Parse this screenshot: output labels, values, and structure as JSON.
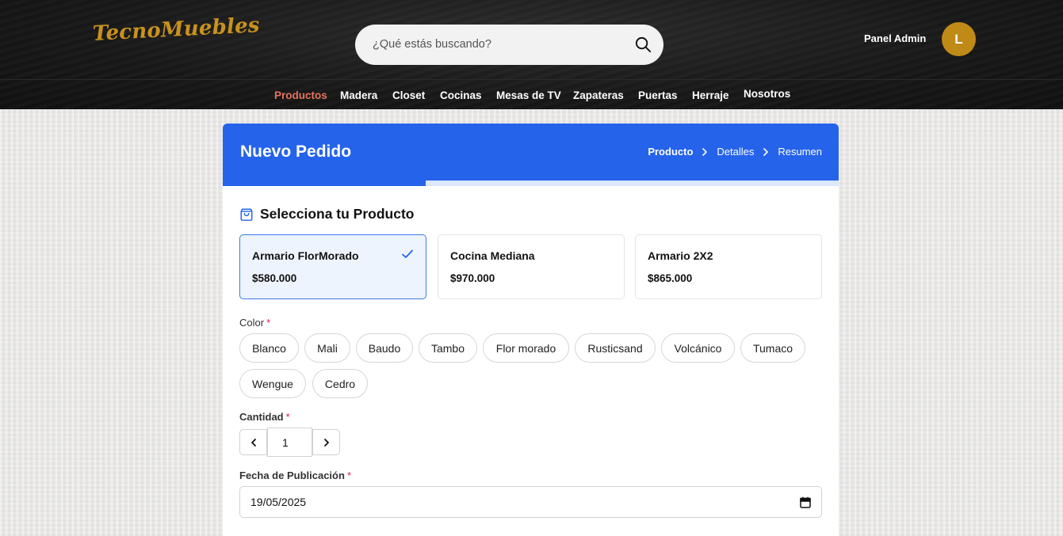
{
  "header": {
    "logo": "TecnoMuebles",
    "search_placeholder": "¿Qué estás buscando?",
    "admin_label": "Panel Admin",
    "avatar_initial": "L"
  },
  "nav": {
    "items": [
      {
        "label": "Productos",
        "active": true
      },
      {
        "label": "Madera"
      },
      {
        "label": "Closet"
      },
      {
        "label": "Cocinas"
      },
      {
        "label": "Mesas de TV"
      },
      {
        "label": "Zapateras"
      },
      {
        "label": "Puertas"
      },
      {
        "label": "Herraje"
      },
      {
        "label": "Nosotros"
      }
    ]
  },
  "order": {
    "title": "Nuevo Pedido",
    "steps": [
      "Producto",
      "Detalles",
      "Resumen"
    ],
    "progress_fraction": 0.33,
    "section_title": "Selecciona tu Producto",
    "products": [
      {
        "name": "Armario FlorMorado",
        "price": "$580.000",
        "selected": true
      },
      {
        "name": "Cocina Mediana",
        "price": "$970.000"
      },
      {
        "name": "Armario 2X2",
        "price": "$865.000"
      }
    ],
    "color_label": "Color",
    "colors": [
      "Blanco",
      "Mali",
      "Baudo",
      "Tambo",
      "Flor morado",
      "Rusticsand",
      "Volcánico",
      "Tumaco",
      "Wengue",
      "Cedro"
    ],
    "quantity_label": "Cantidad",
    "quantity_value": "1",
    "date_label": "Fecha de Publicación",
    "date_value": "19/05/2025",
    "required_mark": "*"
  },
  "colors": {
    "brand_gold": "#c8921c",
    "primary_blue": "#2563eb",
    "nav_active": "#e5735c"
  }
}
